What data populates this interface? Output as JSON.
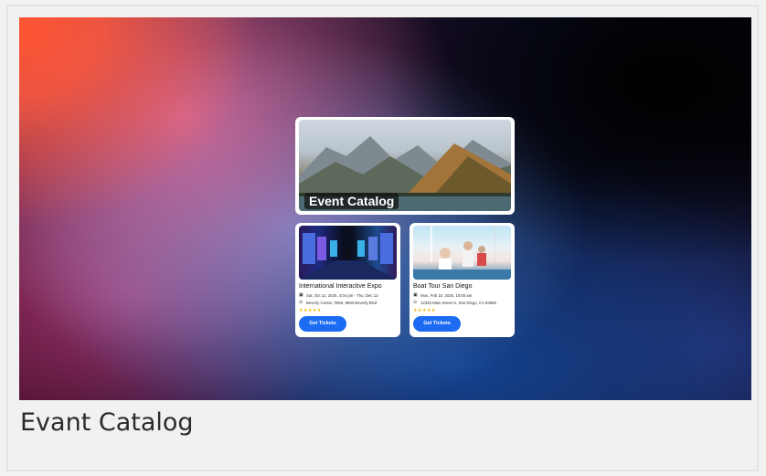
{
  "hero": {
    "title": "Event Catalog"
  },
  "events": [
    {
      "name": "International Interactive Expo",
      "date": "Sat, Oct 12, 2025, 4:04 pm - Thu, Dec 12",
      "location": "Beverly Center, #656, 8500 Beverly Blvd",
      "rating": 5,
      "stars": "★★★★★",
      "button_label": "Get Tickets"
    },
    {
      "name": "Boat Tour San Diego",
      "date": "Mon, Feb 10, 2025, 10:00 am",
      "location": "12345 Main Street S, San Diego, CA 93566",
      "rating": 5,
      "stars": "★★★★★",
      "button_label": "Get Tickets"
    }
  ],
  "caption": "Evant Catalog",
  "colors": {
    "button": "#1b6cf2",
    "stars": "#f5b301"
  },
  "icons": {
    "date": "calendar-icon",
    "location": "location-pin-icon"
  }
}
